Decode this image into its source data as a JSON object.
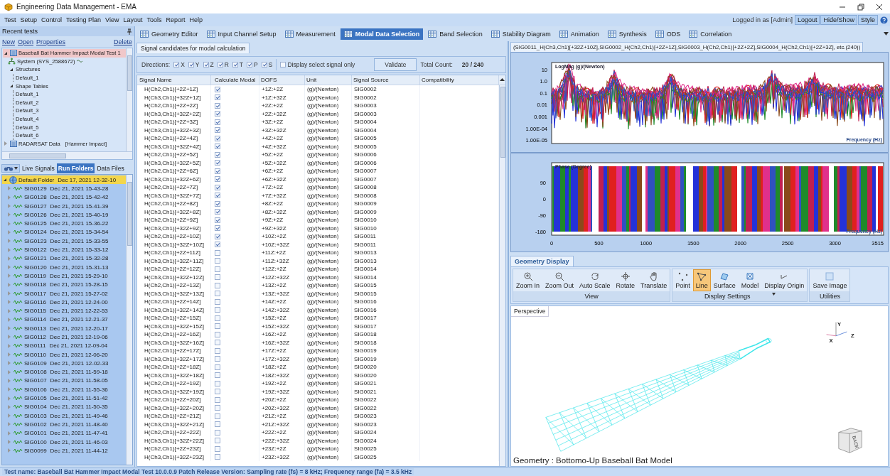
{
  "window": {
    "title": "Engineering Data Management - EMA"
  },
  "menu": [
    "Test",
    "Setup",
    "Control",
    "Testing Plan",
    "View",
    "Layout",
    "Tools",
    "Report",
    "Help"
  ],
  "session": {
    "logged_in": "Logged in as [Admin]",
    "buttons": [
      "Logout",
      "Hide/Show",
      "Style"
    ]
  },
  "left_panel": {
    "title": "Recent tests",
    "links": [
      "New",
      "Open",
      "Properties"
    ],
    "delete_link": "Delete",
    "tree": [
      {
        "label": "Baseball Bat Hammer Impact Modal Test 1",
        "kind": "test",
        "expanded": true,
        "selected": true,
        "children": [
          {
            "label": "System (SYS_2588672)",
            "kind": "system",
            "selected": false
          },
          {
            "label": "Structures",
            "kind": "folder",
            "expanded": true,
            "selected": false,
            "children": [
              {
                "label": "Default_1",
                "kind": "leaf",
                "selected": false
              }
            ]
          },
          {
            "label": "Shape Tables",
            "kind": "folder",
            "expanded": true,
            "selected": false,
            "children": [
              {
                "label": "Default_1",
                "kind": "leaf",
                "selected": false
              },
              {
                "label": "Default_2",
                "kind": "leaf",
                "selected": false
              },
              {
                "label": "Default_3",
                "kind": "leaf",
                "selected": false
              },
              {
                "label": "Default_4",
                "kind": "leaf",
                "selected": false
              },
              {
                "label": "Default_5",
                "kind": "leaf",
                "selected": false
              },
              {
                "label": "Default_6",
                "kind": "leaf",
                "selected": false
              }
            ]
          }
        ]
      },
      {
        "label": "RADARSAT Data",
        "tag": "[Hammer Impact]",
        "kind": "test",
        "expanded": false,
        "selected": false
      }
    ],
    "tabs": [
      {
        "label": "Live Signals",
        "selected": false
      },
      {
        "label": "Run Folders",
        "selected": true
      },
      {
        "label": "Data Files",
        "selected": false
      }
    ],
    "run_folders": [
      {
        "name": "Default Folder",
        "date": "Dec 17, 2021 12-32-10",
        "expanded": true,
        "selected": true,
        "children": [
          {
            "name": "SIG0129",
            "date": "Dec 21, 2021 15-43-28",
            "expanded": false,
            "selected": false
          },
          {
            "name": "SIG0128",
            "date": "Dec 21, 2021 15-42-42",
            "expanded": false,
            "selected": false
          },
          {
            "name": "SIG0127",
            "date": "Dec 21, 2021 15-41-39",
            "expanded": false,
            "selected": false
          },
          {
            "name": "SIG0126",
            "date": "Dec 21, 2021 15-40-19",
            "expanded": false,
            "selected": false
          },
          {
            "name": "SIG0125",
            "date": "Dec 21, 2021 15-36-22",
            "expanded": false,
            "selected": false
          },
          {
            "name": "SIG0124",
            "date": "Dec 21, 2021 15-34-54",
            "expanded": false,
            "selected": false
          },
          {
            "name": "SIG0123",
            "date": "Dec 21, 2021 15-33-55",
            "expanded": false,
            "selected": false
          },
          {
            "name": "SIG0122",
            "date": "Dec 21, 2021 15-33-12",
            "expanded": false,
            "selected": false
          },
          {
            "name": "SIG0121",
            "date": "Dec 21, 2021 15-32-28",
            "expanded": false,
            "selected": false
          },
          {
            "name": "SIG0120",
            "date": "Dec 21, 2021 15-31-13",
            "expanded": false,
            "selected": false
          },
          {
            "name": "SIG0119",
            "date": "Dec 21, 2021 15-29-10",
            "expanded": false,
            "selected": false
          },
          {
            "name": "SIG0118",
            "date": "Dec 21, 2021 15-28-15",
            "expanded": false,
            "selected": false
          },
          {
            "name": "SIG0117",
            "date": "Dec 21, 2021 15-27-02",
            "expanded": false,
            "selected": false
          },
          {
            "name": "SIG0116",
            "date": "Dec 21, 2021 12-24-00",
            "expanded": false,
            "selected": false
          },
          {
            "name": "SIG0115",
            "date": "Dec 21, 2021 12-22-53",
            "expanded": false,
            "selected": false
          },
          {
            "name": "SIG0114",
            "date": "Dec 21, 2021 12-21-37",
            "expanded": false,
            "selected": false
          },
          {
            "name": "SIG0113",
            "date": "Dec 21, 2021 12-20-17",
            "expanded": false,
            "selected": false
          },
          {
            "name": "SIG0112",
            "date": "Dec 21, 2021 12-19-06",
            "expanded": false,
            "selected": false
          },
          {
            "name": "SIG0111",
            "date": "Dec 21, 2021 12-09-04",
            "expanded": false,
            "selected": false
          },
          {
            "name": "SIG0110",
            "date": "Dec 21, 2021 12-06-20",
            "expanded": false,
            "selected": false
          },
          {
            "name": "SIG0109",
            "date": "Dec 21, 2021 12-02-33",
            "expanded": false,
            "selected": false
          },
          {
            "name": "SIG0108",
            "date": "Dec 21, 2021 11-59-18",
            "expanded": false,
            "selected": false
          },
          {
            "name": "SIG0107",
            "date": "Dec 21, 2021 11-58-05",
            "expanded": false,
            "selected": false
          },
          {
            "name": "SIG0106",
            "date": "Dec 21, 2021 11-55-36",
            "expanded": false,
            "selected": false
          },
          {
            "name": "SIG0105",
            "date": "Dec 21, 2021 11-51-42",
            "expanded": false,
            "selected": false
          },
          {
            "name": "SIG0104",
            "date": "Dec 21, 2021 11-50-35",
            "expanded": false,
            "selected": false
          },
          {
            "name": "SIG0103",
            "date": "Dec 21, 2021 11-49-46",
            "expanded": false,
            "selected": false
          },
          {
            "name": "SIG0102",
            "date": "Dec 21, 2021 11-48-40",
            "expanded": false,
            "selected": false
          },
          {
            "name": "SIG0101",
            "date": "Dec 21, 2021 11-47-41",
            "expanded": false,
            "selected": false
          },
          {
            "name": "SIG0100",
            "date": "Dec 21, 2021 11-46-03",
            "expanded": false,
            "selected": false
          },
          {
            "name": "SIG0099",
            "date": "Dec 21, 2021 11-44-12",
            "expanded": false,
            "selected": false
          }
        ]
      }
    ]
  },
  "main_tabs": [
    {
      "label": "Geometry Editor",
      "selected": false
    },
    {
      "label": "Input Channel Setup",
      "selected": false
    },
    {
      "label": "Measurement",
      "selected": false
    },
    {
      "label": "Modal Data Selection",
      "selected": true
    },
    {
      "label": "Band Selection",
      "selected": false
    },
    {
      "label": "Stability Diagram",
      "selected": false
    },
    {
      "label": "Animation",
      "selected": false
    },
    {
      "label": "Synthesis",
      "selected": false
    },
    {
      "label": "ODS",
      "selected": false
    },
    {
      "label": "Correlation",
      "selected": false
    }
  ],
  "signal_panel": {
    "tab": "Signal candidates for modal calculation",
    "directions_label": "Directions:",
    "directions": [
      {
        "label": "X",
        "checked": true
      },
      {
        "label": "Y",
        "checked": true
      },
      {
        "label": "Z",
        "checked": true
      },
      {
        "label": "R",
        "checked": true
      },
      {
        "label": "T",
        "checked": true
      },
      {
        "label": "P",
        "checked": true
      },
      {
        "label": "S",
        "checked": true
      }
    ],
    "display_select": {
      "label": "Display select signal only",
      "checked": false
    },
    "validate": "Validate",
    "total_label": "Total Count:",
    "total": "20 / 240",
    "columns": [
      "Signal Name",
      "Calculate Modal",
      "DOFS",
      "Unit",
      "Signal Source",
      "Compatibility"
    ],
    "rows": [
      {
        "signal_name": "H(Ch2,Ch1)[+2Z+1Z]",
        "calculate_modal": true,
        "dofs": "+1Z:+2Z",
        "unit": "(g)/(Newton)",
        "source": "SIG0002"
      },
      {
        "signal_name": "H(Ch3,Ch1)[+32Z+1Z]",
        "calculate_modal": true,
        "dofs": "+1Z:+32Z",
        "unit": "(g)/(Newton)",
        "source": "SIG0002"
      },
      {
        "signal_name": "H(Ch2,Ch1)[+2Z+2Z]",
        "calculate_modal": true,
        "dofs": "+2Z:+2Z",
        "unit": "(g)/(Newton)",
        "source": "SIG0003"
      },
      {
        "signal_name": "H(Ch3,Ch1)[+32Z+2Z]",
        "calculate_modal": true,
        "dofs": "+2Z:+32Z",
        "unit": "(g)/(Newton)",
        "source": "SIG0003"
      },
      {
        "signal_name": "H(Ch2,Ch1)[+2Z+3Z]",
        "calculate_modal": true,
        "dofs": "+3Z:+2Z",
        "unit": "(g)/(Newton)",
        "source": "SIG0004"
      },
      {
        "signal_name": "H(Ch3,Ch1)[+32Z+3Z]",
        "calculate_modal": true,
        "dofs": "+3Z:+32Z",
        "unit": "(g)/(Newton)",
        "source": "SIG0004"
      },
      {
        "signal_name": "H(Ch2,Ch1)[+2Z+4Z]",
        "calculate_modal": true,
        "dofs": "+4Z:+2Z",
        "unit": "(g)/(Newton)",
        "source": "SIG0005"
      },
      {
        "signal_name": "H(Ch3,Ch1)[+32Z+4Z]",
        "calculate_modal": true,
        "dofs": "+4Z:+32Z",
        "unit": "(g)/(Newton)",
        "source": "SIG0005"
      },
      {
        "signal_name": "H(Ch2,Ch1)[+2Z+5Z]",
        "calculate_modal": true,
        "dofs": "+5Z:+2Z",
        "unit": "(g)/(Newton)",
        "source": "SIG0006"
      },
      {
        "signal_name": "H(Ch3,Ch1)[+32Z+5Z]",
        "calculate_modal": true,
        "dofs": "+5Z:+32Z",
        "unit": "(g)/(Newton)",
        "source": "SIG0006"
      },
      {
        "signal_name": "H(Ch2,Ch1)[+2Z+6Z]",
        "calculate_modal": true,
        "dofs": "+6Z:+2Z",
        "unit": "(g)/(Newton)",
        "source": "SIG0007"
      },
      {
        "signal_name": "H(Ch3,Ch1)[+32Z+6Z]",
        "calculate_modal": true,
        "dofs": "+6Z:+32Z",
        "unit": "(g)/(Newton)",
        "source": "SIG0007"
      },
      {
        "signal_name": "H(Ch2,Ch1)[+2Z+7Z]",
        "calculate_modal": true,
        "dofs": "+7Z:+2Z",
        "unit": "(g)/(Newton)",
        "source": "SIG0008"
      },
      {
        "signal_name": "H(Ch3,Ch1)[+32Z+7Z]",
        "calculate_modal": true,
        "dofs": "+7Z:+32Z",
        "unit": "(g)/(Newton)",
        "source": "SIG0008"
      },
      {
        "signal_name": "H(Ch2,Ch1)[+2Z+8Z]",
        "calculate_modal": true,
        "dofs": "+8Z:+2Z",
        "unit": "(g)/(Newton)",
        "source": "SIG0009"
      },
      {
        "signal_name": "H(Ch3,Ch1)[+32Z+8Z]",
        "calculate_modal": true,
        "dofs": "+8Z:+32Z",
        "unit": "(g)/(Newton)",
        "source": "SIG0009"
      },
      {
        "signal_name": "H(Ch2,Ch1)[+2Z+9Z]",
        "calculate_modal": true,
        "dofs": "+9Z:+2Z",
        "unit": "(g)/(Newton)",
        "source": "SIG0010"
      },
      {
        "signal_name": "H(Ch3,Ch1)[+32Z+9Z]",
        "calculate_modal": true,
        "dofs": "+9Z:+32Z",
        "unit": "(g)/(Newton)",
        "source": "SIG0010"
      },
      {
        "signal_name": "H(Ch2,Ch1)[+2Z+10Z]",
        "calculate_modal": true,
        "dofs": "+10Z:+2Z",
        "unit": "(g)/(Newton)",
        "source": "SIG0011"
      },
      {
        "signal_name": "H(Ch3,Ch1)[+32Z+10Z]",
        "calculate_modal": true,
        "dofs": "+10Z:+32Z",
        "unit": "(g)/(Newton)",
        "source": "SIG0011"
      },
      {
        "signal_name": "H(Ch2,Ch1)[+2Z+11Z]",
        "calculate_modal": false,
        "dofs": "+11Z:+2Z",
        "unit": "(g)/(Newton)",
        "source": "SIG0013"
      },
      {
        "signal_name": "H(Ch3,Ch1)[+32Z+11Z]",
        "calculate_modal": false,
        "dofs": "+11Z:+32Z",
        "unit": "(g)/(Newton)",
        "source": "SIG0013"
      },
      {
        "signal_name": "H(Ch2,Ch1)[+2Z+12Z]",
        "calculate_modal": false,
        "dofs": "+12Z:+2Z",
        "unit": "(g)/(Newton)",
        "source": "SIG0014"
      },
      {
        "signal_name": "H(Ch3,Ch1)[+32Z+12Z]",
        "calculate_modal": false,
        "dofs": "+12Z:+32Z",
        "unit": "(g)/(Newton)",
        "source": "SIG0014"
      },
      {
        "signal_name": "H(Ch2,Ch1)[+2Z+13Z]",
        "calculate_modal": false,
        "dofs": "+13Z:+2Z",
        "unit": "(g)/(Newton)",
        "source": "SIG0015"
      },
      {
        "signal_name": "H(Ch3,Ch1)[+32Z+13Z]",
        "calculate_modal": false,
        "dofs": "+13Z:+32Z",
        "unit": "(g)/(Newton)",
        "source": "SIG0015"
      },
      {
        "signal_name": "H(Ch2,Ch1)[+2Z+14Z]",
        "calculate_modal": false,
        "dofs": "+14Z:+2Z",
        "unit": "(g)/(Newton)",
        "source": "SIG0016"
      },
      {
        "signal_name": "H(Ch3,Ch1)[+32Z+14Z]",
        "calculate_modal": false,
        "dofs": "+14Z:+32Z",
        "unit": "(g)/(Newton)",
        "source": "SIG0016"
      },
      {
        "signal_name": "H(Ch2,Ch1)[+2Z+15Z]",
        "calculate_modal": false,
        "dofs": "+15Z:+2Z",
        "unit": "(g)/(Newton)",
        "source": "SIG0017"
      },
      {
        "signal_name": "H(Ch3,Ch1)[+32Z+15Z]",
        "calculate_modal": false,
        "dofs": "+15Z:+32Z",
        "unit": "(g)/(Newton)",
        "source": "SIG0017"
      },
      {
        "signal_name": "H(Ch2,Ch1)[+2Z+16Z]",
        "calculate_modal": false,
        "dofs": "+16Z:+2Z",
        "unit": "(g)/(Newton)",
        "source": "SIG0018"
      },
      {
        "signal_name": "H(Ch3,Ch1)[+32Z+16Z]",
        "calculate_modal": false,
        "dofs": "+16Z:+32Z",
        "unit": "(g)/(Newton)",
        "source": "SIG0018"
      },
      {
        "signal_name": "H(Ch2,Ch1)[+2Z+17Z]",
        "calculate_modal": false,
        "dofs": "+17Z:+2Z",
        "unit": "(g)/(Newton)",
        "source": "SIG0019"
      },
      {
        "signal_name": "H(Ch3,Ch1)[+32Z+17Z]",
        "calculate_modal": false,
        "dofs": "+17Z:+32Z",
        "unit": "(g)/(Newton)",
        "source": "SIG0019"
      },
      {
        "signal_name": "H(Ch2,Ch1)[+2Z+18Z]",
        "calculate_modal": false,
        "dofs": "+18Z:+2Z",
        "unit": "(g)/(Newton)",
        "source": "SIG0020"
      },
      {
        "signal_name": "H(Ch3,Ch1)[+32Z+18Z]",
        "calculate_modal": false,
        "dofs": "+18Z:+32Z",
        "unit": "(g)/(Newton)",
        "source": "SIG0020"
      },
      {
        "signal_name": "H(Ch2,Ch1)[+2Z+19Z]",
        "calculate_modal": false,
        "dofs": "+19Z:+2Z",
        "unit": "(g)/(Newton)",
        "source": "SIG0021"
      },
      {
        "signal_name": "H(Ch3,Ch1)[+32Z+19Z]",
        "calculate_modal": false,
        "dofs": "+19Z:+32Z",
        "unit": "(g)/(Newton)",
        "source": "SIG0021"
      },
      {
        "signal_name": "H(Ch2,Ch1)[+2Z+20Z]",
        "calculate_modal": false,
        "dofs": "+20Z:+2Z",
        "unit": "(g)/(Newton)",
        "source": "SIG0022"
      },
      {
        "signal_name": "H(Ch3,Ch1)[+32Z+20Z]",
        "calculate_modal": false,
        "dofs": "+20Z:+32Z",
        "unit": "(g)/(Newton)",
        "source": "SIG0022"
      },
      {
        "signal_name": "H(Ch2,Ch1)[+2Z+21Z]",
        "calculate_modal": false,
        "dofs": "+21Z:+2Z",
        "unit": "(g)/(Newton)",
        "source": "SIG0023"
      },
      {
        "signal_name": "H(Ch3,Ch1)[+32Z+21Z]",
        "calculate_modal": false,
        "dofs": "+21Z:+32Z",
        "unit": "(g)/(Newton)",
        "source": "SIG0023"
      },
      {
        "signal_name": "H(Ch2,Ch1)[+2Z+22Z]",
        "calculate_modal": false,
        "dofs": "+22Z:+2Z",
        "unit": "(g)/(Newton)",
        "source": "SIG0024"
      },
      {
        "signal_name": "H(Ch3,Ch1)[+32Z+22Z]",
        "calculate_modal": false,
        "dofs": "+22Z:+32Z",
        "unit": "(g)/(Newton)",
        "source": "SIG0024"
      },
      {
        "signal_name": "H(Ch2,Ch1)[+2Z+23Z]",
        "calculate_modal": false,
        "dofs": "+23Z:+2Z",
        "unit": "(g)/(Newton)",
        "source": "SIG0025"
      },
      {
        "signal_name": "H(Ch3,Ch1)[+32Z+23Z]",
        "calculate_modal": false,
        "dofs": "+23Z:+32Z",
        "unit": "(g)/(Newton)",
        "source": "SIG0025"
      }
    ]
  },
  "plot_panel": {
    "tab": "(SIG0011_H(Ch3,Ch1)[+32Z+10Z],SIG0002_H(Ch2,Ch1)[+2Z+1Z],SIG0003_H(Ch2,Ch1)[+2Z+2Z],SIG0004_H(Ch2,Ch1)[+2Z+3Z], etc.(240))",
    "magnitude": {
      "ylabel": "LogMag (g)/(Newton)",
      "xlabel": "Frequency (Hz)",
      "y_tick_labels": [
        "10",
        "1.0",
        "0.1",
        "0.01",
        "0.001",
        "1.00E-04",
        "1.00E-05"
      ]
    },
    "phase": {
      "ylabel": "Phase (Degree)",
      "xlabel": "Frequency (Hz)",
      "y_tick_labels": [
        "90",
        "0",
        "-90",
        "-180"
      ],
      "x_tick_labels": [
        "0",
        "500",
        "1000",
        "1500",
        "2000",
        "2500",
        "3000",
        "3515"
      ]
    }
  },
  "geometry": {
    "tab": "Geometry Display",
    "groups": [
      {
        "label": "View",
        "buttons": [
          {
            "label": "Zoom In",
            "selected": false
          },
          {
            "label": "Zoom Out",
            "selected": false
          },
          {
            "label": "Auto Scale",
            "selected": false
          },
          {
            "label": "Rotate",
            "selected": false
          },
          {
            "label": "Translate",
            "selected": false
          }
        ]
      },
      {
        "label": "Display Settings",
        "buttons": [
          {
            "label": "Point",
            "selected": false
          },
          {
            "label": "Line",
            "selected": true
          },
          {
            "label": "Surface",
            "selected": false
          },
          {
            "label": "Model",
            "selected": false
          },
          {
            "label": "Display Origin",
            "selected": false
          }
        ]
      },
      {
        "label": "Utilities",
        "buttons": [
          {
            "label": "Save Image",
            "selected": false
          }
        ]
      }
    ],
    "view_label": "Perspective",
    "axis_labels": [
      "Y",
      "Z",
      "X"
    ],
    "cube_face": "BACK",
    "caption": "Geometry : Bottomo-Up Baseball Bat Model"
  },
  "status_bar": "Test name: Baseball Bat Hammer Impact Modal Test 10.0.0.9 Patch Release Version: Sampling rate (fs) = 8 kHz; Frequency range (fa) = 3.5 kHz"
}
